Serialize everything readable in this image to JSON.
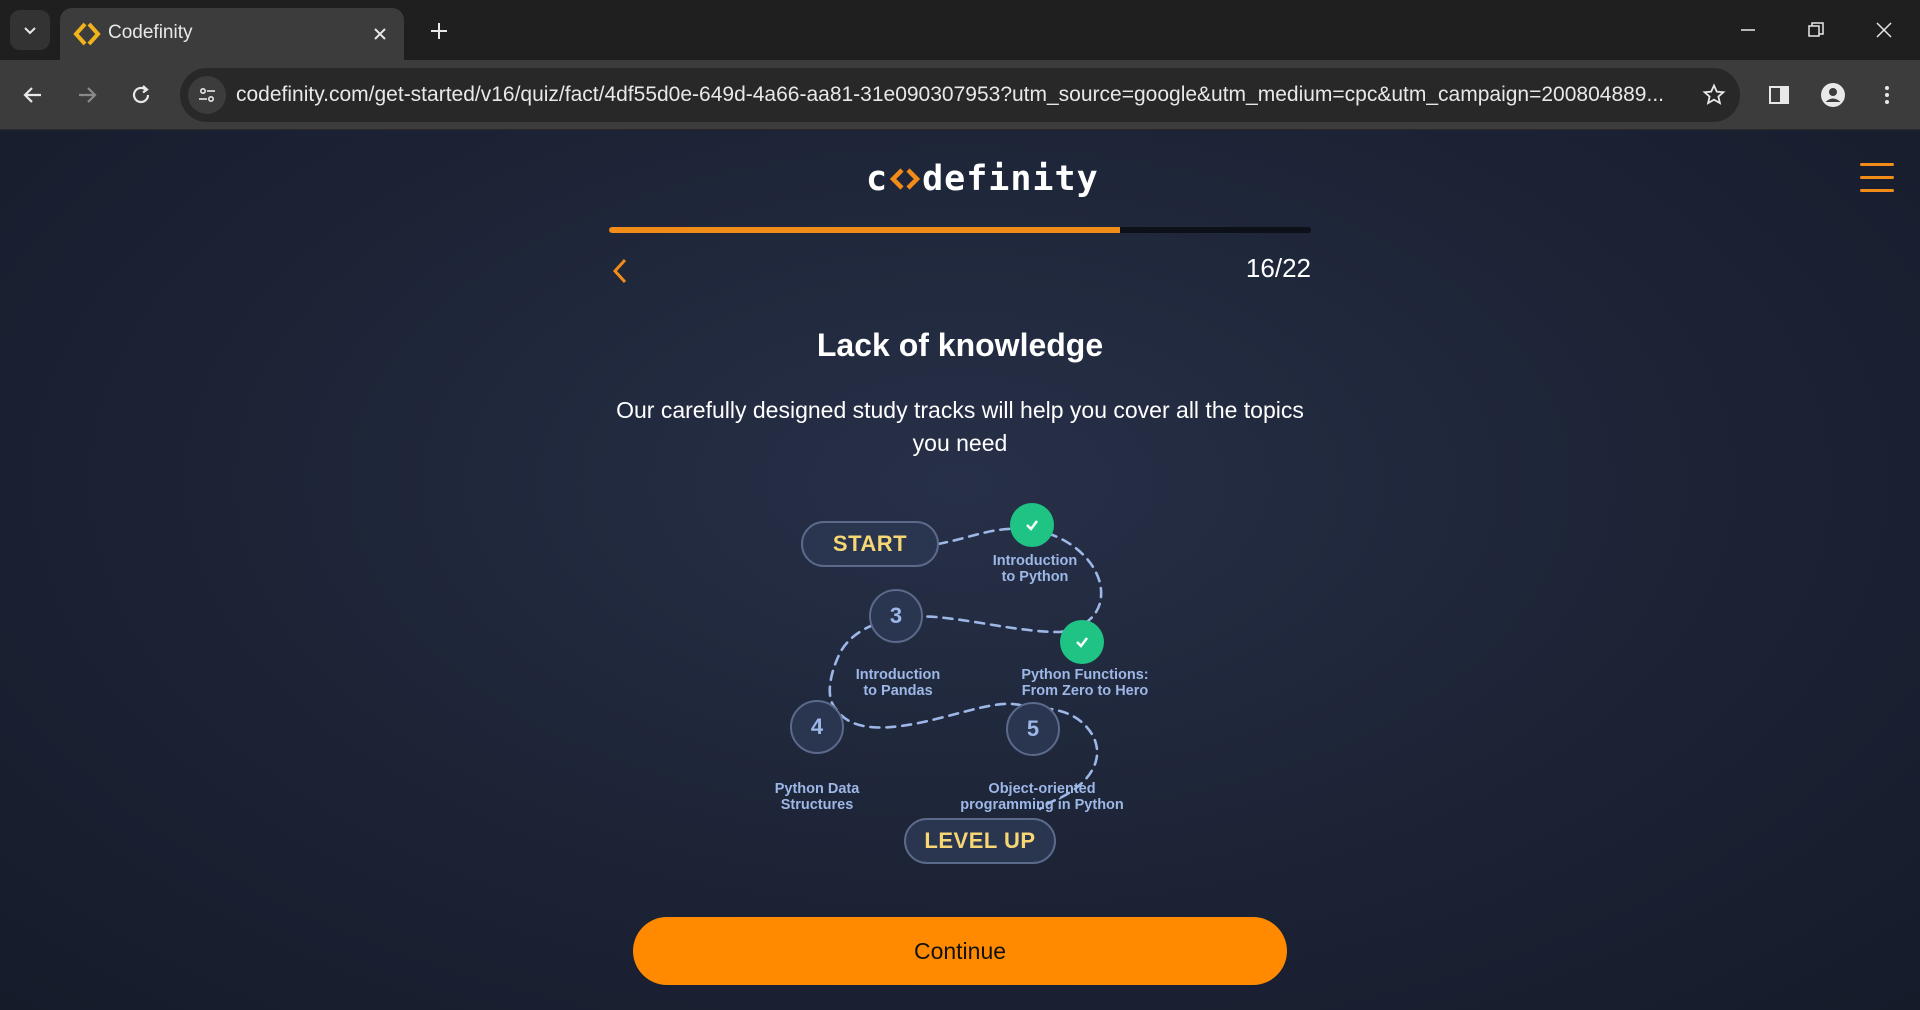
{
  "browser": {
    "tab_title": "Codefinity",
    "url": "codefinity.com/get-started/v16/quiz/fact/4df55d0e-649d-4a66-aa81-31e090307953?utm_source=google&utm_medium=cpc&utm_campaign=200804889..."
  },
  "header": {
    "logo_left": "c",
    "logo_right": "definity",
    "accent_color": "#f28c18"
  },
  "quiz": {
    "step_label": "16/22",
    "progress": {
      "current": 16,
      "total": 22
    },
    "title": "Lack of knowledge",
    "subtitle": "Our carefully designed study tracks will help you cover all the topics you need",
    "continue_label": "Continue"
  },
  "roadmap": {
    "start_label": "START",
    "end_label": "LEVEL UP",
    "steps": [
      {
        "marker": "check",
        "label": "Introduction\nto Python"
      },
      {
        "marker": "check",
        "label": "Python Functions:\nFrom Zero to Hero"
      },
      {
        "marker": "3",
        "label": "Introduction\nto Pandas"
      },
      {
        "marker": "4",
        "label": "Python Data\nStructures"
      },
      {
        "marker": "5",
        "label": "Object-oriented\nprogramming in Python"
      }
    ]
  }
}
